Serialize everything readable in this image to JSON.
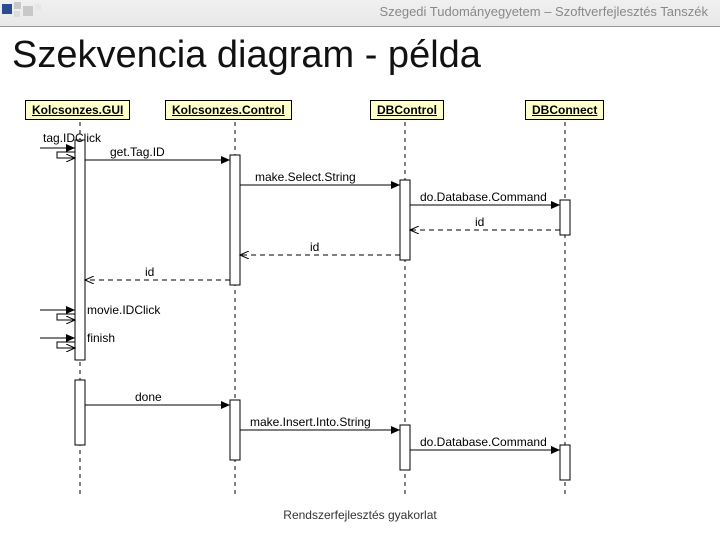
{
  "header": {
    "institution": "Szegedi Tudományegyetem – Szoftverfejlesztés Tanszék"
  },
  "title": "Szekvencia diagram - példa",
  "footer": "Rendszerfejlesztés gyakorlat",
  "objects": {
    "gui": "Kolcsonzes.GUI",
    "control": "Kolcsonzes.Control",
    "dbcontrol": "DBControl",
    "dbconnect": "DBConnect"
  },
  "messages": {
    "tagDClick": "tag.IDClick",
    "getTagID": "get.Tag.ID",
    "makeSelect": "make.Select.String",
    "doDbCmd1": "do.Database.Command",
    "id1": "id",
    "id2": "id",
    "id3": "id",
    "movieDClick": "movie.IDClick",
    "finish": "finish",
    "done": "done",
    "makeInsert": "make.Insert.Into.String",
    "doDbCmd2": "do.Database.Command"
  },
  "chart_data": {
    "type": "sequence-diagram",
    "title": "Szekvencia diagram - példa",
    "participants": [
      "Kolcsonzes.GUI",
      "Kolcsonzes.Control",
      "DBControl",
      "DBConnect"
    ],
    "interactions": [
      {
        "from": "external",
        "to": "Kolcsonzes.GUI",
        "label": "tag.IDClick",
        "kind": "sync"
      },
      {
        "from": "Kolcsonzes.GUI",
        "to": "Kolcsonzes.Control",
        "label": "get.Tag.ID",
        "kind": "sync"
      },
      {
        "from": "Kolcsonzes.Control",
        "to": "DBControl",
        "label": "make.Select.String",
        "kind": "sync"
      },
      {
        "from": "DBControl",
        "to": "DBConnect",
        "label": "do.Database.Command",
        "kind": "sync"
      },
      {
        "from": "DBConnect",
        "to": "DBControl",
        "label": "id",
        "kind": "return"
      },
      {
        "from": "DBControl",
        "to": "Kolcsonzes.Control",
        "label": "id",
        "kind": "return"
      },
      {
        "from": "Kolcsonzes.Control",
        "to": "Kolcsonzes.GUI",
        "label": "id",
        "kind": "return"
      },
      {
        "from": "external",
        "to": "Kolcsonzes.GUI",
        "label": "movie.IDClick",
        "kind": "sync"
      },
      {
        "from": "external",
        "to": "Kolcsonzes.GUI",
        "label": "finish",
        "kind": "sync"
      },
      {
        "from": "Kolcsonzes.GUI",
        "to": "Kolcsonzes.Control",
        "label": "done",
        "kind": "sync"
      },
      {
        "from": "Kolcsonzes.Control",
        "to": "DBControl",
        "label": "make.Insert.Into.String",
        "kind": "sync"
      },
      {
        "from": "DBControl",
        "to": "DBConnect",
        "label": "do.Database.Command",
        "kind": "sync"
      }
    ]
  }
}
